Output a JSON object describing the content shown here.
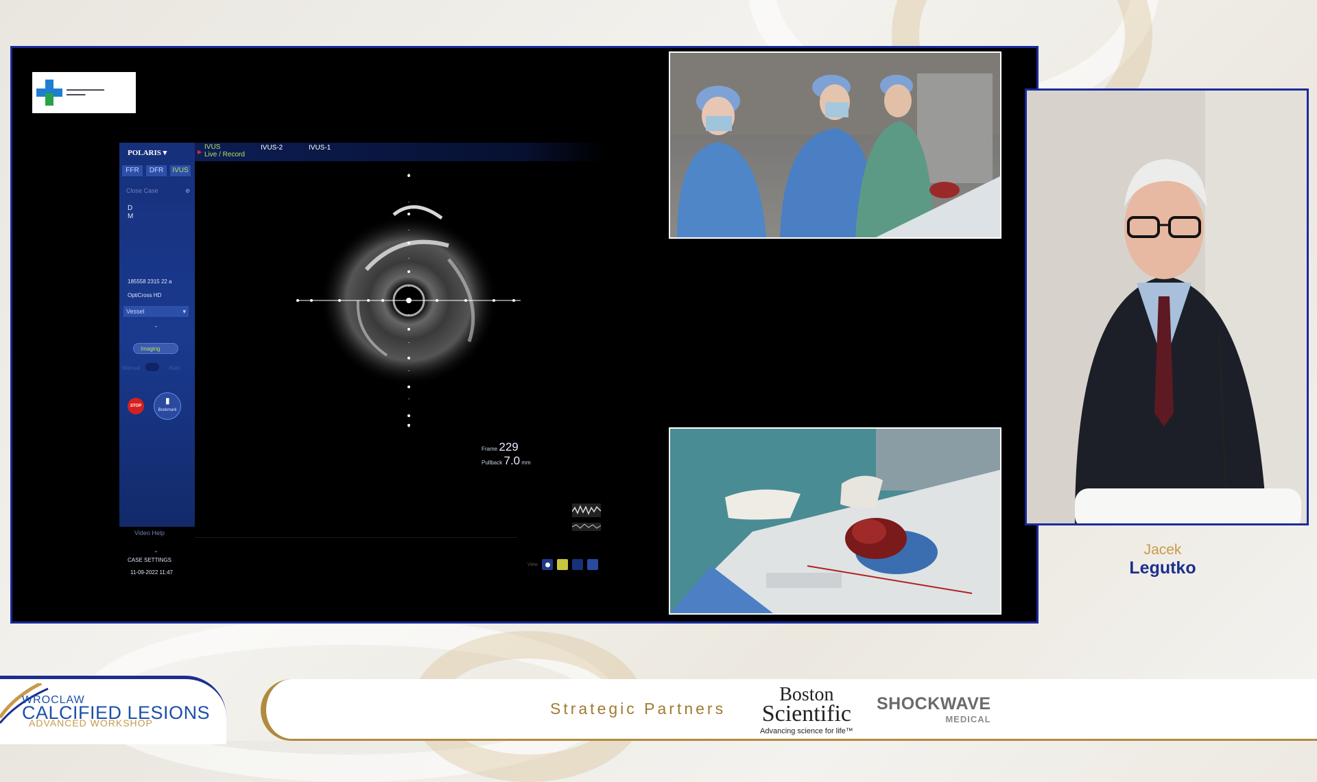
{
  "ivus": {
    "polaris": "POLARIS ▾",
    "modes": [
      "FFR",
      "DFR",
      "IVUS"
    ],
    "top_tab_main": "IVUS",
    "top_tab_sub": "Live / Record",
    "top_tab_2": "IVUS-2",
    "top_tab_3": "IVUS-1",
    "close_case": "Close Case",
    "patient_d": "D",
    "patient_m": "M",
    "patient_id": "185558 2315 22 a",
    "catheter": "OptiCross HD",
    "vessel": "Vessel",
    "imaging": "Imaging",
    "manual": "Manual",
    "auto": "Auto",
    "stop": "STOP",
    "bookmark": "Bookmark",
    "video_help": "Video Help",
    "case_settings": "CASE SETTINGS",
    "case_date": "11-09-2022 11:47",
    "frame_label": "Frame",
    "frame_value": "229",
    "pullback_label": "Pullback",
    "pullback_value": "7.0",
    "pullback_unit": "mm",
    "view_label": "View"
  },
  "presenter": {
    "first_name": "Jacek",
    "last_name": "Legutko"
  },
  "banner": {
    "workshop_line1": "WROCLAW",
    "workshop_line2": "CALCIFIED LESIONS",
    "workshop_line3": "ADVANCED WORKSHOP",
    "strategic_partners": "Strategic Partners",
    "bs_line1": "Boston",
    "bs_line2": "Scientific",
    "bs_tagline": "Advancing science for life™",
    "sw_name": "SHOCKWAVE",
    "sw_sub": "MEDICAL"
  },
  "colors": {
    "frame_border": "#1a2a9a",
    "accent_gold": "#c79a4a",
    "name_blue": "#1b2f8e",
    "console_blue": "#1a3a8f"
  }
}
